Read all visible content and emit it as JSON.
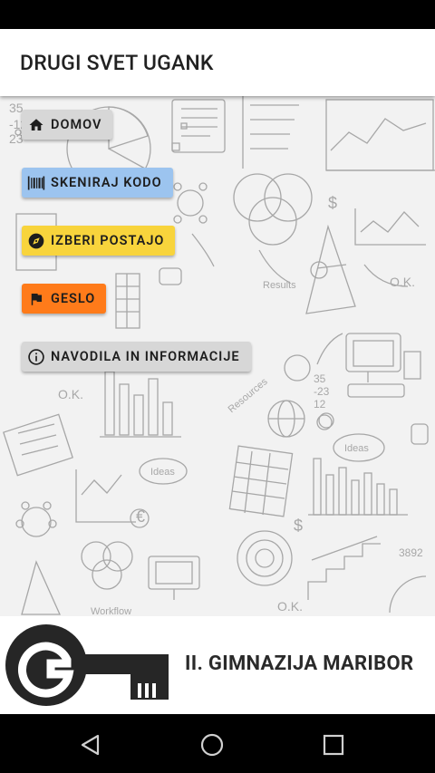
{
  "app": {
    "title": "DRUGI SVET UGANK"
  },
  "menu": {
    "buttons": [
      {
        "label": "DOMOV",
        "icon": "home-icon",
        "color": "#d7d7d7"
      },
      {
        "label": "SKENIRAJ KODO",
        "icon": "barcode-icon",
        "color": "#9cc4ef"
      },
      {
        "label": "IZBERI POSTAJO",
        "icon": "compass-icon",
        "color": "#f8d43c"
      },
      {
        "label": "GESLO",
        "icon": "flag-icon",
        "color": "#ff7b1a"
      },
      {
        "label": "NAVODILA IN INFORMACIJE",
        "icon": "info-icon",
        "color": "#d7d7d7"
      }
    ]
  },
  "footer": {
    "school_name": "II. GIMNAZIJA MARIBOR",
    "logo_letter": "G"
  },
  "navbar": {
    "back_icon": "back-triangle-icon",
    "home_icon": "home-circle-icon",
    "recents_icon": "recents-square-icon"
  }
}
